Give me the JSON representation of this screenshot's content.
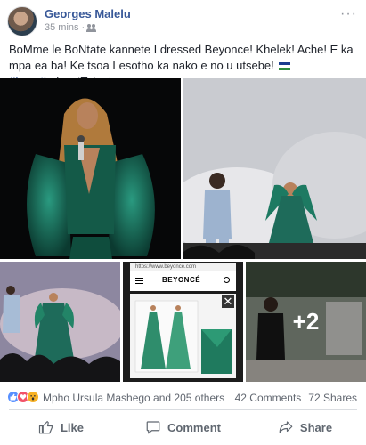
{
  "post": {
    "author": "Georges Malelu",
    "time": "35 mins",
    "separator": "·",
    "audience_icon": "friends-icon",
    "more_icon": "ellipsis-icon",
    "text_main": "BoMme le BoNtate kannete I dressed Beyonce! Khelek! Ache! E ka mpa ea ba! Ke tsoa Lesotho ka nako e no u utsebe!",
    "flag_icon": "lesotho-flag-icon",
    "hashtag": "#Lesotho",
    "text_suffix": "'sgotTalent"
  },
  "photos": {
    "more_count": "+2",
    "website": {
      "url": "https://www.beyonce.com",
      "logo": "BEYONCÉ"
    }
  },
  "reactions": {
    "icons": [
      "like-reaction-icon",
      "love-reaction-icon",
      "wow-reaction-icon"
    ],
    "summary": "Mpho Ursula Mashego and 205 others",
    "comments": "42 Comments",
    "shares": "72 Shares"
  },
  "actions": {
    "like": "Like",
    "comment": "Comment",
    "share": "Share"
  },
  "colors": {
    "link": "#385898",
    "muted": "#90949c",
    "action": "#606770",
    "like_blue": "#5890ff",
    "love_red": "#f25268",
    "wow_yellow": "#f7b125",
    "dress_green": "#1e6b5a"
  }
}
